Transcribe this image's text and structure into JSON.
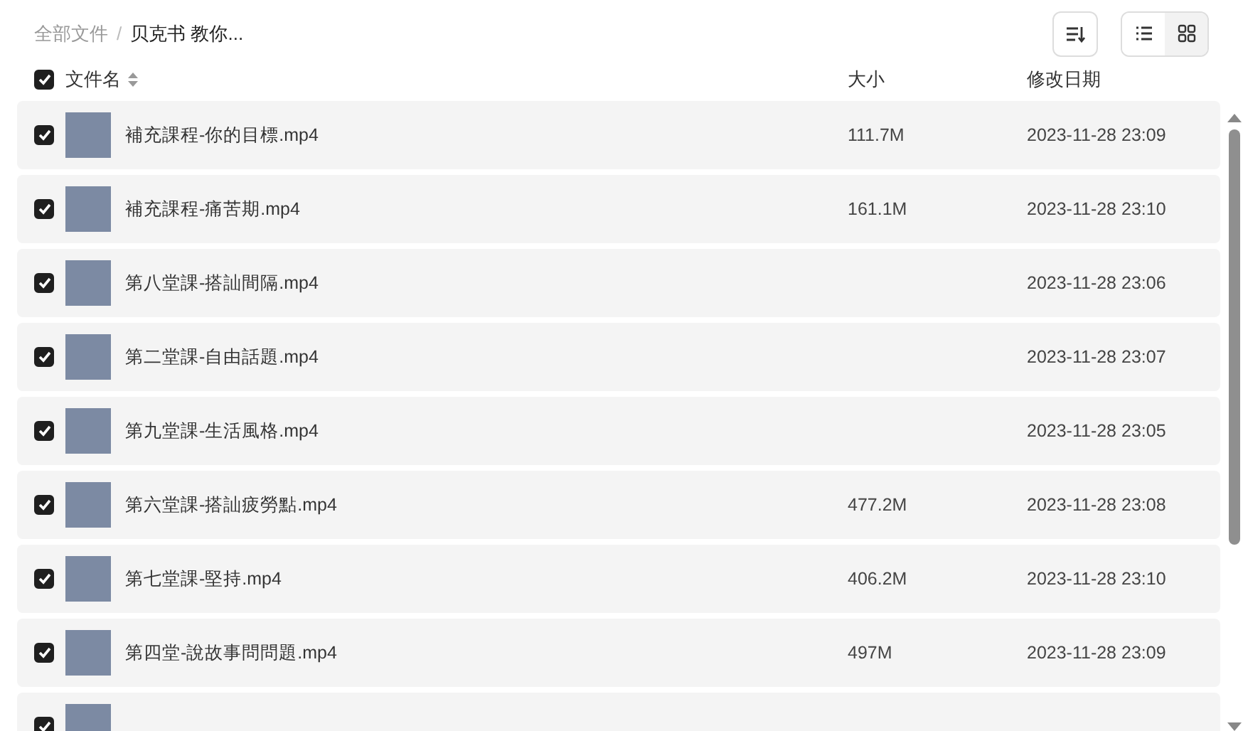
{
  "breadcrumb_separator": "/",
  "breadcrumb": [
    {
      "label": "全部文件",
      "current": false
    },
    {
      "label": "贝克书 教你...",
      "current": true
    }
  ],
  "view_toggle": [
    {
      "kind": "list",
      "selected": true
    },
    {
      "kind": "grid",
      "selected": false
    }
  ],
  "header": {
    "checked": true,
    "columns": [
      "文件名",
      "大小",
      "修改日期"
    ]
  },
  "rows": [
    {
      "checked": true,
      "name": "補充課程-你的目標.mp4",
      "size": "111.7M",
      "modified": "2023-11-28 23:09"
    },
    {
      "checked": true,
      "name": "補充課程-痛苦期.mp4",
      "size": "161.1M",
      "modified": "2023-11-28 23:10"
    },
    {
      "checked": true,
      "name": "第八堂課-搭訕間隔.mp4",
      "modified": "2023-11-28 23:06"
    },
    {
      "checked": true,
      "name": "第二堂課-自由話題.mp4",
      "modified": "2023-11-28 23:07"
    },
    {
      "checked": true,
      "name": "第九堂課-生活風格.mp4",
      "modified": "2023-11-28 23:05"
    },
    {
      "checked": true,
      "name": "第六堂課-搭訕疲勞點.mp4",
      "size": "477.2M",
      "modified": "2023-11-28 23:08"
    },
    {
      "checked": true,
      "name": "第七堂課-堅持.mp4",
      "size": "406.2M",
      "modified": "2023-11-28 23:10"
    },
    {
      "checked": true,
      "name": "第四堂-說故事問問題.mp4",
      "size": "497M",
      "modified": "2023-11-28 23:09"
    },
    {
      "checked": true
    }
  ]
}
